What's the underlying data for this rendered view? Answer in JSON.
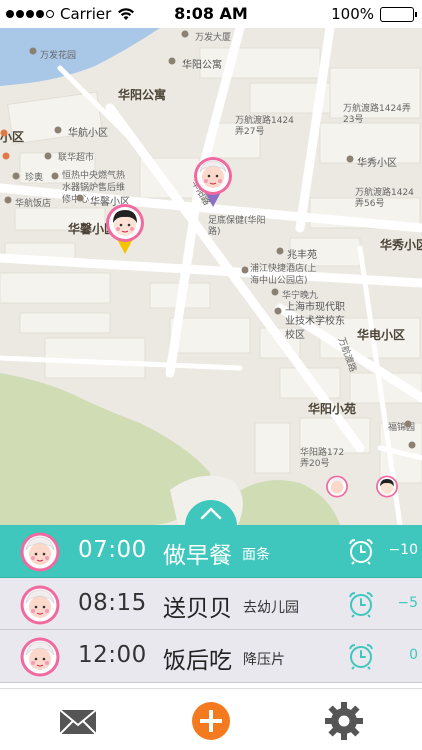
{
  "status_bar": {
    "carrier": "Carrier",
    "time": "8:08 AM",
    "battery": "100%"
  },
  "map": {
    "labels": [
      {
        "text": "万发大厦",
        "cls": "road"
      },
      {
        "text": "万发花园",
        "cls": "road"
      },
      {
        "text": "华阳公寓",
        "cls": ""
      },
      {
        "text": "华阳公寓",
        "cls": "big"
      },
      {
        "text": "万航渡路1424弄27号",
        "cls": "road"
      },
      {
        "text": "万航渡路1424弄23号",
        "cls": "road"
      },
      {
        "text": "华航小区",
        "cls": ""
      },
      {
        "text": "小区",
        "cls": "big"
      },
      {
        "text": "联华超市",
        "cls": "road"
      },
      {
        "text": "珍奥",
        "cls": "road"
      },
      {
        "text": "恒热中央燃气热水器锅炉售后维修中心",
        "cls": "road"
      },
      {
        "text": "华秀小区",
        "cls": ""
      },
      {
        "text": "华航饭店",
        "cls": "road"
      },
      {
        "text": "华馨小区",
        "cls": ""
      },
      {
        "text": "华馨小区",
        "cls": "big"
      },
      {
        "text": "华阳路",
        "cls": "road"
      },
      {
        "text": "足底保健(华阳路)",
        "cls": "road"
      },
      {
        "text": "万航渡路1424弄56号",
        "cls": "road"
      },
      {
        "text": "兆丰苑",
        "cls": ""
      },
      {
        "text": "华秀小区",
        "cls": "big"
      },
      {
        "text": "浦江快捷酒店(上海中山公园店)",
        "cls": "road"
      },
      {
        "text": "华宁晚九",
        "cls": "road"
      },
      {
        "text": "上海市现代职业技术学校东校区",
        "cls": ""
      },
      {
        "text": "华电小区",
        "cls": "big"
      },
      {
        "text": "华阳小苑",
        "cls": "big"
      },
      {
        "text": "福锦园",
        "cls": "road"
      },
      {
        "text": "华阳路172弄20号",
        "cls": "road"
      },
      {
        "text": "万航渡路",
        "cls": "road"
      }
    ]
  },
  "tasks": [
    {
      "time": "07:00",
      "title": "做早餐",
      "sub": "面条",
      "offset": "−10",
      "active": true
    },
    {
      "time": "08:15",
      "title": "送贝贝",
      "sub": "去幼儿园",
      "offset": "−5",
      "active": false
    },
    {
      "time": "12:00",
      "title": "饭后吃",
      "sub": "降压片",
      "offset": "0",
      "active": false
    }
  ],
  "tab_bar": {
    "icons": [
      "mail-icon",
      "add-icon",
      "settings-icon"
    ]
  },
  "colors": {
    "accent": "#3fc7bd",
    "add": "#f47a1f",
    "avatar_ring": "#f06aa0"
  }
}
